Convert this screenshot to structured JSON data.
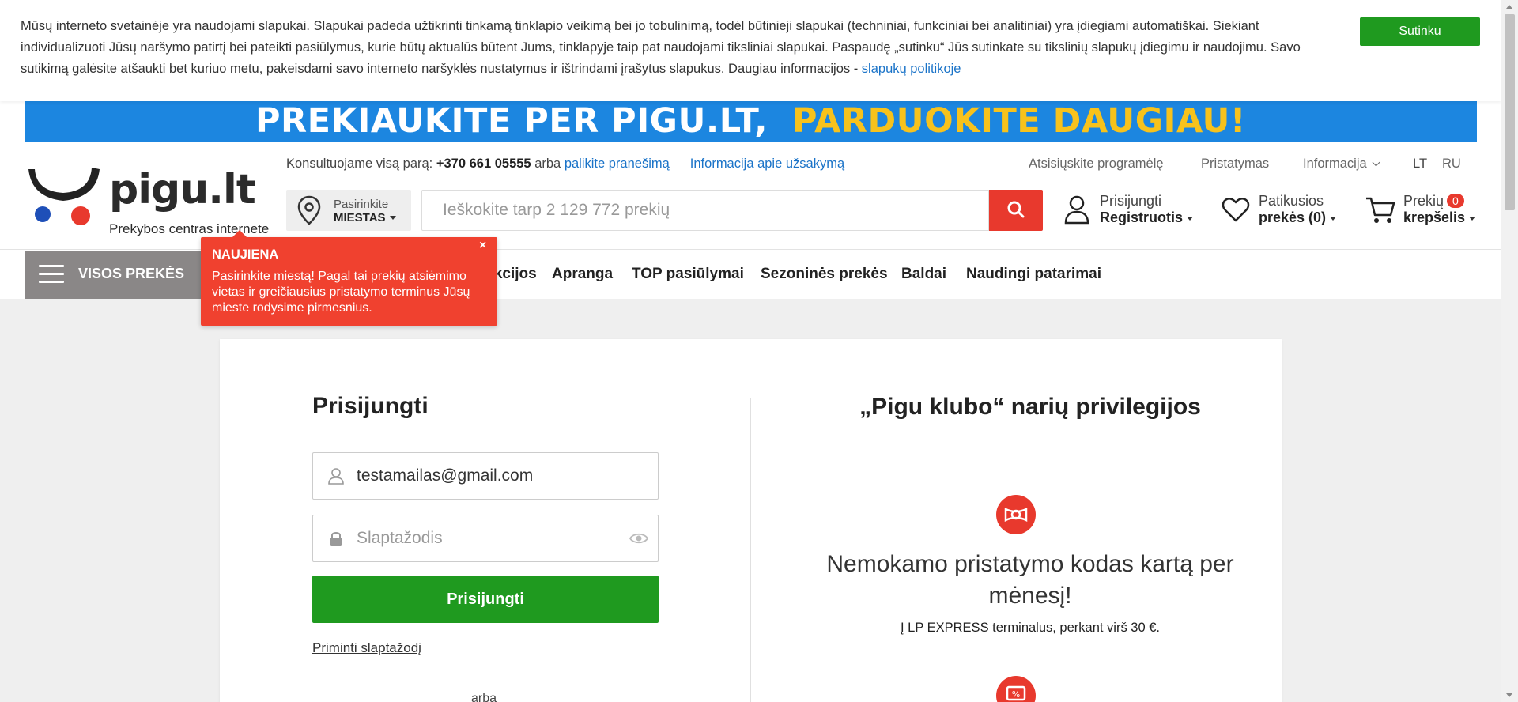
{
  "cookie": {
    "text": "Mūsų interneto svetainėje yra naudojami slapukai. Slapukai padeda užtikrinti tinkamą tinklapio veikimą bei jo tobulinimą, todėl būtinieji slapukai (techniniai, funkciniai bei analitiniai) yra įdiegiami automatiškai. Siekiant individualizuoti Jūsų naršymo patirtį bei pateikti pasiūlymus, kurie būtų aktualūs būtent Jums, tinklapyje taip pat naudojami tiksliniai slapukai. Paspaudę „sutinku“ Jūs sutinkate su tikslinių slapukų įdiegimu ir naudojimu. Savo sutikimą galėsite atšaukti bet kuriuo metu, pakeisdami savo interneto naršyklės nustatymus ir ištrindami įrašytus slapukus. Daugiau informacijos - ",
    "link": "slapukų politikoje",
    "accept": "Sutinku"
  },
  "banner": {
    "part1": "PREKIAUKITE PER PIGU.LT,",
    "part2": "PARDUOKITE DAUGIAU!"
  },
  "logo": {
    "name": "pigu.lt",
    "tagline": "Prekybos centras internete"
  },
  "topbar": {
    "consult": "Konsultuojame visą parą: ",
    "phone": "+370 661 05555",
    "or": " arba ",
    "leave_message": "palikite pranešimą",
    "order_info": "Informacija apie užsakymą",
    "app": "Atsisiųskite programėlę",
    "delivery": "Pristatymas",
    "info": "Informacija",
    "lang_lt": "LT",
    "lang_ru": "RU"
  },
  "city": {
    "label": "Pasirinkite",
    "value": "MIESTAS"
  },
  "search": {
    "placeholder": "Ieškokite tarp 2 129 772 prekių"
  },
  "account": {
    "line1": "Prisijungti",
    "line2": "Registruotis"
  },
  "favorites": {
    "line1": "Patikusios",
    "line2": "prekės (0)"
  },
  "cart": {
    "line1": "Prekių",
    "count": "0",
    "line2": "krepšelis"
  },
  "nav": {
    "all": "VISOS PREKĖS",
    "items": [
      "...kcijos",
      "Apranga",
      "TOP pasiūlymai",
      "Sezoninės prekės",
      "Baldai",
      "Naudingi patarimai"
    ]
  },
  "tooltip": {
    "title": "NAUJIENA",
    "text": "Pasirinkite miestą! Pagal tai prekių atsiėmimo vietas ir greičiausius pristatymo terminus Jūsų mieste rodysime pirmesnius.",
    "close": "×"
  },
  "login": {
    "title": "Prisijungti",
    "email_value": "testamailas@gmail.com",
    "password_placeholder": "Slaptažodis",
    "submit": "Prisijungti",
    "remind": "Priminti slaptažodį",
    "or": "arba"
  },
  "club": {
    "title": "„Pigu klubo“ narių privilegijos",
    "benefit_title": "Nemokamo pristatymo kodas kartą per mėnesį!",
    "benefit_note": "Į LP EXPRESS terminalus, perkant virš 30 €."
  },
  "colors": {
    "accent_red": "#e8392d",
    "green": "#1f9a1f",
    "banner_blue": "#1c86e0",
    "banner_yellow": "#f7c21c",
    "link_blue": "#1a73c8"
  }
}
